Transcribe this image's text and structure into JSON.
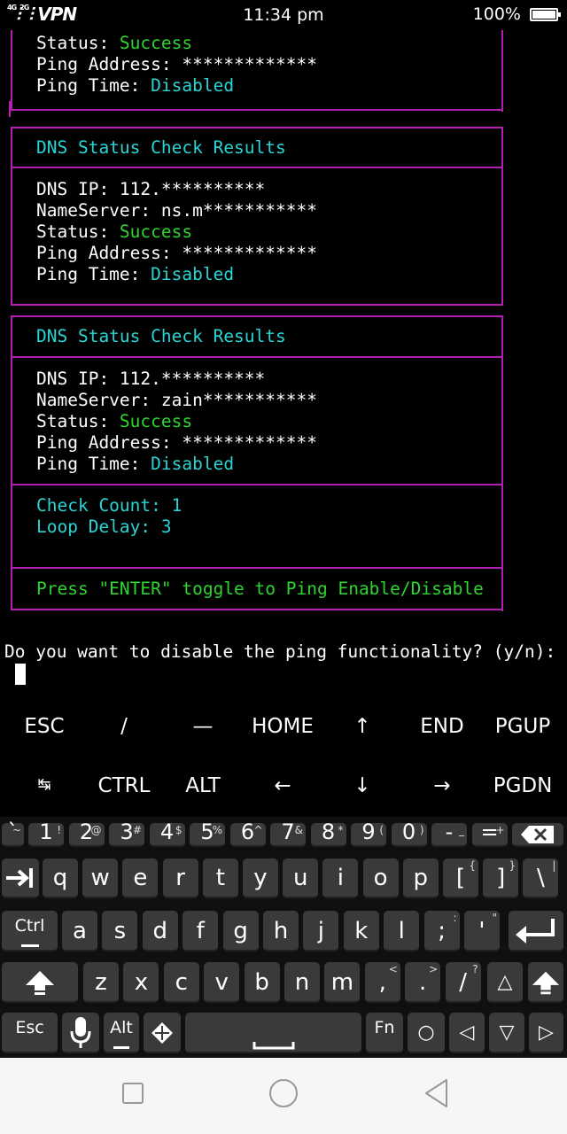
{
  "status_bar": {
    "network": "4G",
    "network2": "2G",
    "vpn": "VPN",
    "time": "11:34 pm",
    "battery": "100%"
  },
  "terminal": {
    "block0": {
      "status_label": "Status: ",
      "status_value": "Success",
      "ping_address": "Ping Address: *************",
      "ping_time_label": "Ping Time: ",
      "ping_time_value": "Disabled"
    },
    "block1": {
      "title": "DNS Status Check Results",
      "dns_ip": "DNS IP: 112.**********",
      "nameserver": "NameServer: ns.m***********",
      "status_label": "Status: ",
      "status_value": "Success",
      "ping_address": "Ping Address: *************",
      "ping_time_label": "Ping Time: ",
      "ping_time_value": "Disabled"
    },
    "block2": {
      "title": "DNS Status Check Results",
      "dns_ip": "DNS IP: 112.**********",
      "nameserver": "NameServer: zain***********",
      "status_label": "Status: ",
      "status_value": "Success",
      "ping_address": "Ping Address: *************",
      "ping_time_label": "Ping Time: ",
      "ping_time_value": "Disabled",
      "check_count": "Check Count: 1",
      "loop_delay": "Loop Delay: 3",
      "hint": "Press \"ENTER\" toggle to Ping Enable/Disable"
    },
    "prompt": "Do you want to disable the ping functionality? (y/n):"
  },
  "extra_keys": {
    "row1": [
      "ESC",
      "/",
      "—",
      "HOME",
      "↑",
      "END",
      "PGUP"
    ],
    "row2": [
      "↹",
      "CTRL",
      "ALT",
      "←",
      "↓",
      "→",
      "PGDN"
    ]
  },
  "keyboard": {
    "num_row": [
      {
        "m": "1",
        "s": "!"
      },
      {
        "m": "2",
        "s": "@"
      },
      {
        "m": "3",
        "s": "#"
      },
      {
        "m": "4",
        "s": "$"
      },
      {
        "m": "5",
        "s": "%"
      },
      {
        "m": "6",
        "s": "^"
      },
      {
        "m": "7",
        "s": "&"
      },
      {
        "m": "8",
        "s": "*"
      },
      {
        "m": "9",
        "s": "("
      },
      {
        "m": "0",
        "s": ")"
      },
      {
        "m": "-",
        "s": "_"
      },
      {
        "m": "=",
        "s": "+"
      }
    ],
    "backtick": {
      "m": "`",
      "s": "~"
    },
    "row_q": [
      {
        "m": "q"
      },
      {
        "m": "w"
      },
      {
        "m": "e"
      },
      {
        "m": "r"
      },
      {
        "m": "t"
      },
      {
        "m": "y"
      },
      {
        "m": "u"
      },
      {
        "m": "i"
      },
      {
        "m": "o"
      },
      {
        "m": "p"
      },
      {
        "m": "[",
        "s": "{"
      },
      {
        "m": "]",
        "s": "}"
      },
      {
        "m": "\\",
        "s": "|"
      }
    ],
    "row_a": [
      {
        "m": "a"
      },
      {
        "m": "s"
      },
      {
        "m": "d"
      },
      {
        "m": "f"
      },
      {
        "m": "g"
      },
      {
        "m": "h"
      },
      {
        "m": "j"
      },
      {
        "m": "k"
      },
      {
        "m": "l"
      },
      {
        "m": ";",
        "s": ":"
      },
      {
        "m": "'",
        "s": "\""
      }
    ],
    "row_z": [
      {
        "m": "z"
      },
      {
        "m": "x"
      },
      {
        "m": "c"
      },
      {
        "m": "v"
      },
      {
        "m": "b"
      },
      {
        "m": "n"
      },
      {
        "m": "m"
      },
      {
        "m": ",",
        "s": "<"
      },
      {
        "m": ".",
        "s": ">"
      },
      {
        "m": "/",
        "s": "?"
      }
    ],
    "ctrl": "Ctrl",
    "esc": "Esc",
    "alt": "Alt",
    "fn": "Fn",
    "up_arrow": "△",
    "circle": "○",
    "left_arrow": "◁",
    "down_arrow": "▽",
    "right_arrow": "▷"
  },
  "icons": {
    "backspace": "backspace-icon",
    "tab": "tab-icon",
    "enter": "enter-icon",
    "shift": "shift-icon",
    "mic": "microphone-icon",
    "settings": "diamond-menu-icon",
    "space": "space-icon"
  }
}
